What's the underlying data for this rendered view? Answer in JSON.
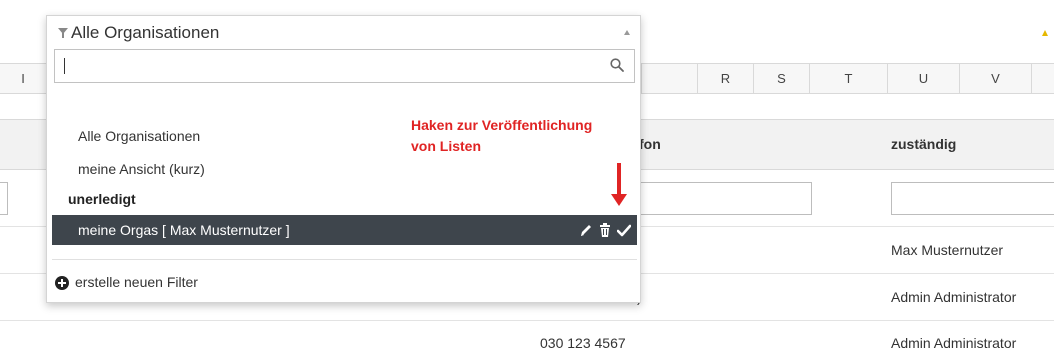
{
  "sheet": {
    "column_letters": [
      "I",
      "R",
      "S",
      "T",
      "U",
      "V"
    ],
    "headers": {
      "phone_tail": "fon",
      "responsible": "zuständig"
    },
    "rows": [
      {
        "phone_tail": ")",
        "responsible": "Max Musternutzer"
      },
      {
        "phone_tail": ")",
        "responsible": "Admin Administrator"
      },
      {
        "phone": "030 123 4567",
        "responsible": "Admin Administrator"
      }
    ]
  },
  "dropdown": {
    "title": "Alle Organisationen",
    "search": {
      "value": "",
      "placeholder": ""
    },
    "options": [
      "Alle Organisationen",
      "meine Ansicht (kurz)"
    ],
    "group_label": "unerledigt",
    "selected_item": "meine Orgas [ Max Musternutzer ]",
    "row_icons": [
      "pencil-icon",
      "trash-icon",
      "checkmark-icon"
    ],
    "new_filter_label": "erstelle neuen Filter"
  },
  "annotation": {
    "line1": "Haken zur Veröffentlichung",
    "line2": "von Listen",
    "color": "#e02424"
  },
  "colors": {
    "selected_row_bg": "#3e454c",
    "annotation": "#e02424"
  }
}
